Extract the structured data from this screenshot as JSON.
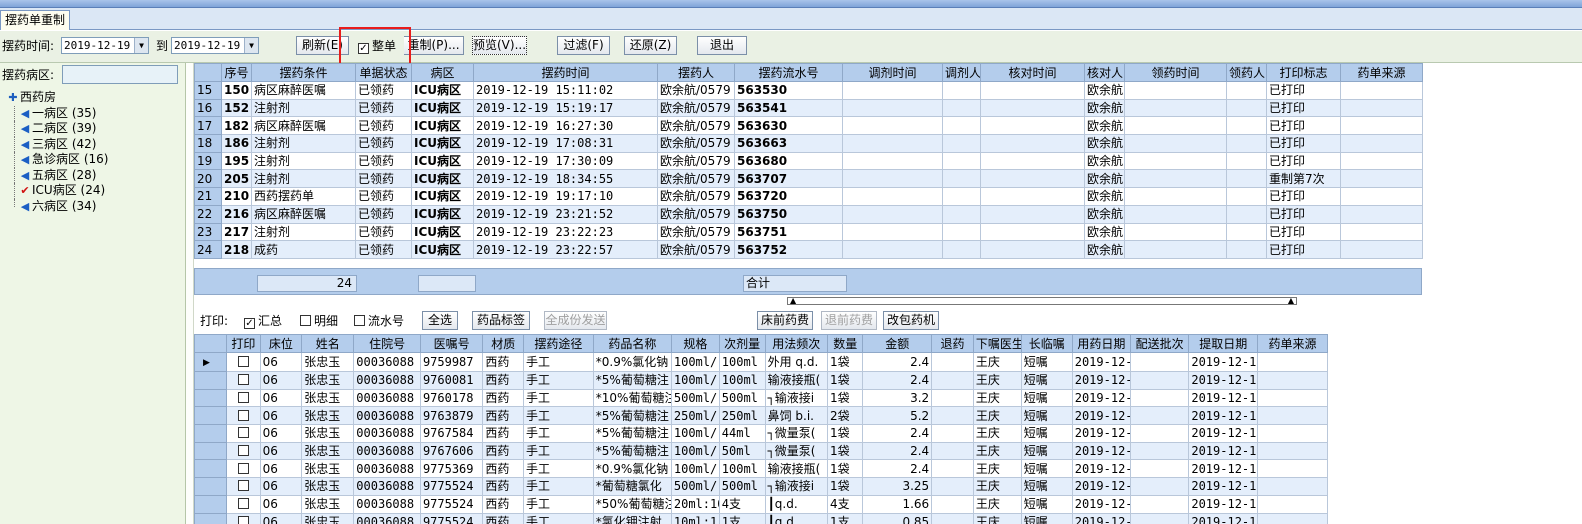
{
  "window": {
    "tab_title": "摆药单重制"
  },
  "toolbar": {
    "time_label": "摆药时间:",
    "date_from": "2019-12-19",
    "to_label": "到",
    "date_to": "2019-12-19",
    "refresh": "刷新(E)",
    "whole_label": "整单",
    "whole_checked": true,
    "reprint": "重制(P)...",
    "preview": "预览(V)...",
    "filter": "过滤(F)",
    "restore": "还原(Z)",
    "exit": "退出"
  },
  "left": {
    "ward_label": "摆药病区:",
    "ward_value": "",
    "tree": [
      {
        "label": "西药房",
        "icon": "plus",
        "root": true
      },
      {
        "label": "一病区 (35)",
        "icon": "arrow"
      },
      {
        "label": "二病区 (39)",
        "icon": "arrow"
      },
      {
        "label": "三病区 (42)",
        "icon": "arrow"
      },
      {
        "label": "急诊病区 (16)",
        "icon": "arrow"
      },
      {
        "label": "五病区 (28)",
        "icon": "arrow"
      },
      {
        "label": "ICU病区 (24)",
        "icon": "check",
        "selected": true
      },
      {
        "label": "六病区 (34)",
        "icon": "arrow"
      }
    ]
  },
  "top_grid": {
    "columns": [
      "序号",
      "摆药条件",
      "单据状态",
      "病区",
      "摆药时间",
      "摆药人",
      "摆药流水号",
      "调剂时间",
      "调剂人",
      "核对时间",
      "核对人",
      "领药时间",
      "领药人",
      "打印标志",
      "药单来源"
    ],
    "rows": [
      {
        "rn": "15",
        "seq": "150",
        "cond": "病区麻醉医嘱",
        "status": "已领药",
        "ward": "ICU病区",
        "time": "2019-12-19 15:11:02",
        "person": "欧余航/0579",
        "serial": "563530",
        "checker": "欧余航",
        "flag": "已打印"
      },
      {
        "rn": "16",
        "seq": "152",
        "cond": "注射剂",
        "status": "已领药",
        "ward": "ICU病区",
        "time": "2019-12-19 15:19:17",
        "person": "欧余航/0579",
        "serial": "563541",
        "checker": "欧余航",
        "flag": "已打印"
      },
      {
        "rn": "17",
        "seq": "182",
        "cond": "病区麻醉医嘱",
        "status": "已领药",
        "ward": "ICU病区",
        "time": "2019-12-19 16:27:30",
        "person": "欧余航/0579",
        "serial": "563630",
        "checker": "欧余航",
        "flag": "已打印"
      },
      {
        "rn": "18",
        "seq": "186",
        "cond": "注射剂",
        "status": "已领药",
        "ward": "ICU病区",
        "time": "2019-12-19 17:08:31",
        "person": "欧余航/0579",
        "serial": "563663",
        "checker": "欧余航",
        "flag": "已打印"
      },
      {
        "rn": "19",
        "seq": "195",
        "cond": "注射剂",
        "status": "已领药",
        "ward": "ICU病区",
        "time": "2019-12-19 17:30:09",
        "person": "欧余航/0579",
        "serial": "563680",
        "checker": "欧余航",
        "flag": "已打印"
      },
      {
        "rn": "20",
        "seq": "205",
        "cond": "注射剂",
        "status": "已领药",
        "ward": "ICU病区",
        "time": "2019-12-19 18:34:55",
        "person": "欧余航/0579",
        "serial": "563707",
        "checker": "欧余航",
        "flag": "重制第7次"
      },
      {
        "rn": "21",
        "seq": "210",
        "cond": "西药摆药单",
        "status": "已领药",
        "ward": "ICU病区",
        "time": "2019-12-19 19:17:10",
        "person": "欧余航/0579",
        "serial": "563720",
        "checker": "欧余航",
        "flag": "已打印"
      },
      {
        "rn": "22",
        "seq": "216",
        "cond": "病区麻醉医嘱",
        "status": "已领药",
        "ward": "ICU病区",
        "time": "2019-12-19 23:21:52",
        "person": "欧余航/0579",
        "serial": "563750",
        "checker": "欧余航",
        "flag": "已打印"
      },
      {
        "rn": "23",
        "seq": "217",
        "cond": "注射剂",
        "status": "已领药",
        "ward": "ICU病区",
        "time": "2019-12-19 23:22:23",
        "person": "欧余航/0579",
        "serial": "563751",
        "checker": "欧余航",
        "flag": "已打印"
      },
      {
        "rn": "24",
        "seq": "218",
        "cond": "成药",
        "status": "已领药",
        "ward": "ICU病区",
        "time": "2019-12-19 23:22:57",
        "person": "欧余航/0579",
        "serial": "563752",
        "checker": "欧余航",
        "flag": "已打印"
      }
    ],
    "summary_count": "24",
    "summary_label": "合计"
  },
  "print_bar": {
    "print_label": "打印:",
    "summary_opt": "汇总",
    "summary_checked": true,
    "detail_opt": "明细",
    "detail_checked": false,
    "serial_opt": "流水号",
    "serial_checked": false,
    "select_all": "全选",
    "drug_label": "药品标签",
    "all_send": "全成份发送",
    "bed_fee": "床前药费",
    "return_fee": "退前药费",
    "repack": "改包药机"
  },
  "bottom_grid": {
    "columns": [
      "打印",
      "床位",
      "姓名",
      "住院号",
      "医嘱号",
      "材质",
      "摆药途径",
      "药品名称",
      "规格",
      "次剂量",
      "用法频次",
      "数量",
      "金额",
      "退药",
      "下嘱医生",
      "长临嘱",
      "用药日期",
      "配送批次",
      "提取日期",
      "药单来源"
    ],
    "rows": [
      {
        "bed": "06",
        "name": "张忠玉",
        "inp": "00036088",
        "order": "9759987",
        "mat": "西药",
        "route": "手工",
        "drug": "*0.9%氯化钠",
        "spec": "100ml/:",
        "dose": "100ml",
        "usage": "外用 q.d.",
        "qty": "1袋",
        "amount": "2.4",
        "doctor": "王庆",
        "type": "短嘱",
        "date": "2019-12-",
        "ext": "2019-12-1"
      },
      {
        "bed": "06",
        "name": "张忠玉",
        "inp": "00036088",
        "order": "9760081",
        "mat": "西药",
        "route": "手工",
        "drug": "*5%葡萄糖注",
        "spec": "100ml/:",
        "dose": "100ml",
        "usage": "输液接瓶(",
        "qty": "1袋",
        "amount": "2.4",
        "doctor": "王庆",
        "type": "短嘱",
        "date": "2019-12-",
        "ext": "2019-12-1"
      },
      {
        "bed": "06",
        "name": "张忠玉",
        "inp": "00036088",
        "order": "9760178",
        "mat": "西药",
        "route": "手工",
        "drug": "*10%葡萄糖注",
        "spec": "500ml/:",
        "dose": "500ml",
        "usage": "┐输液接i",
        "qty": "1袋",
        "amount": "3.2",
        "doctor": "王庆",
        "type": "短嘱",
        "date": "2019-12-",
        "ext": "2019-12-1"
      },
      {
        "bed": "06",
        "name": "张忠玉",
        "inp": "00036088",
        "order": "9763879",
        "mat": "西药",
        "route": "手工",
        "drug": "*5%葡萄糖注",
        "spec": "250ml/:",
        "dose": "250ml",
        "usage": "鼻饲 b.i.",
        "qty": "2袋",
        "amount": "5.2",
        "doctor": "王庆",
        "type": "短嘱",
        "date": "2019-12-",
        "ext": "2019-12-1"
      },
      {
        "bed": "06",
        "name": "张忠玉",
        "inp": "00036088",
        "order": "9767584",
        "mat": "西药",
        "route": "手工",
        "drug": "*5%葡萄糖注",
        "spec": "100ml/:",
        "dose": "44ml",
        "usage": "┐微量泵(",
        "qty": "1袋",
        "amount": "2.4",
        "doctor": "王庆",
        "type": "短嘱",
        "date": "2019-12-",
        "ext": "2019-12-1"
      },
      {
        "bed": "06",
        "name": "张忠玉",
        "inp": "00036088",
        "order": "9767606",
        "mat": "西药",
        "route": "手工",
        "drug": "*5%葡萄糖注",
        "spec": "100ml/:",
        "dose": "50ml",
        "usage": "┐微量泵(",
        "qty": "1袋",
        "amount": "2.4",
        "doctor": "王庆",
        "type": "短嘱",
        "date": "2019-12-",
        "ext": "2019-12-1"
      },
      {
        "bed": "06",
        "name": "张忠玉",
        "inp": "00036088",
        "order": "9775369",
        "mat": "西药",
        "route": "手工",
        "drug": "*0.9%氯化钠",
        "spec": "100ml/:",
        "dose": "100ml",
        "usage": "输液接瓶(",
        "qty": "1袋",
        "amount": "2.4",
        "doctor": "王庆",
        "type": "短嘱",
        "date": "2019-12-",
        "ext": "2019-12-1"
      },
      {
        "bed": "06",
        "name": "张忠玉",
        "inp": "00036088",
        "order": "9775524",
        "mat": "西药",
        "route": "手工",
        "drug": "*葡萄糖氯化",
        "spec": "500ml/:",
        "dose": "500ml",
        "usage": "┐输液接i",
        "qty": "1袋",
        "amount": "3.25",
        "doctor": "王庆",
        "type": "短嘱",
        "date": "2019-12-",
        "ext": "2019-12-1"
      },
      {
        "bed": "06",
        "name": "张忠玉",
        "inp": "00036088",
        "order": "9775524",
        "mat": "西药",
        "route": "手工",
        "drug": "*50%葡萄糖注",
        "spec": "20ml:10",
        "dose": "4支",
        "usage": "┃q.d.",
        "qty": "4支",
        "amount": "1.66",
        "doctor": "王庆",
        "type": "短嘱",
        "date": "2019-12-",
        "ext": "2019-12-1"
      },
      {
        "bed": "06",
        "name": "张忠玉",
        "inp": "00036088",
        "order": "9775524",
        "mat": "西药",
        "route": "手工",
        "drug": "*氯化钾注射",
        "spec": "10ml:1",
        "dose": "1支",
        "usage": "┃q.d.",
        "qty": "1支",
        "amount": "0.85",
        "doctor": "王庆",
        "type": "短嘱",
        "date": "2019-12-",
        "ext": "2019-12-1"
      }
    ]
  },
  "colors": {
    "accent": "#b4cdec",
    "panel": "#eef6e6",
    "highlight": "#e81c1c",
    "alt_row": "#e4eefb"
  }
}
